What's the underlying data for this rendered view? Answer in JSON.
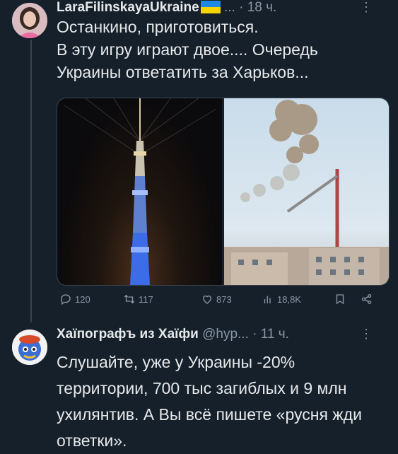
{
  "tweet1": {
    "author": "LaraFilinskayaUkraine",
    "meta": "... · 18 ч.",
    "text": "Останкино, приготовиться.\nВ эту игру  играют двое.... Очередь Украины ответатить за Харьков...",
    "stats": {
      "replies": "120",
      "retweets": "117",
      "likes": "873",
      "views": "18,8K"
    },
    "flag_colors": [
      "#1d8ae6",
      "#f6d400"
    ]
  },
  "tweet2": {
    "author": "Хаїпографъ из Хаїфи",
    "meta": "@hyp... · 11 ч.",
    "text": "Слушайте, уже у Украины -20% территории, 700 тыс загиблых и 9 млн ухилянтив. А Вы всё пишете «русня жди ответки»."
  },
  "more_label": "⋮",
  "icons": [
    "reply-icon",
    "retweet-icon",
    "like-icon",
    "views-icon",
    "bookmark-icon",
    "share-icon"
  ]
}
